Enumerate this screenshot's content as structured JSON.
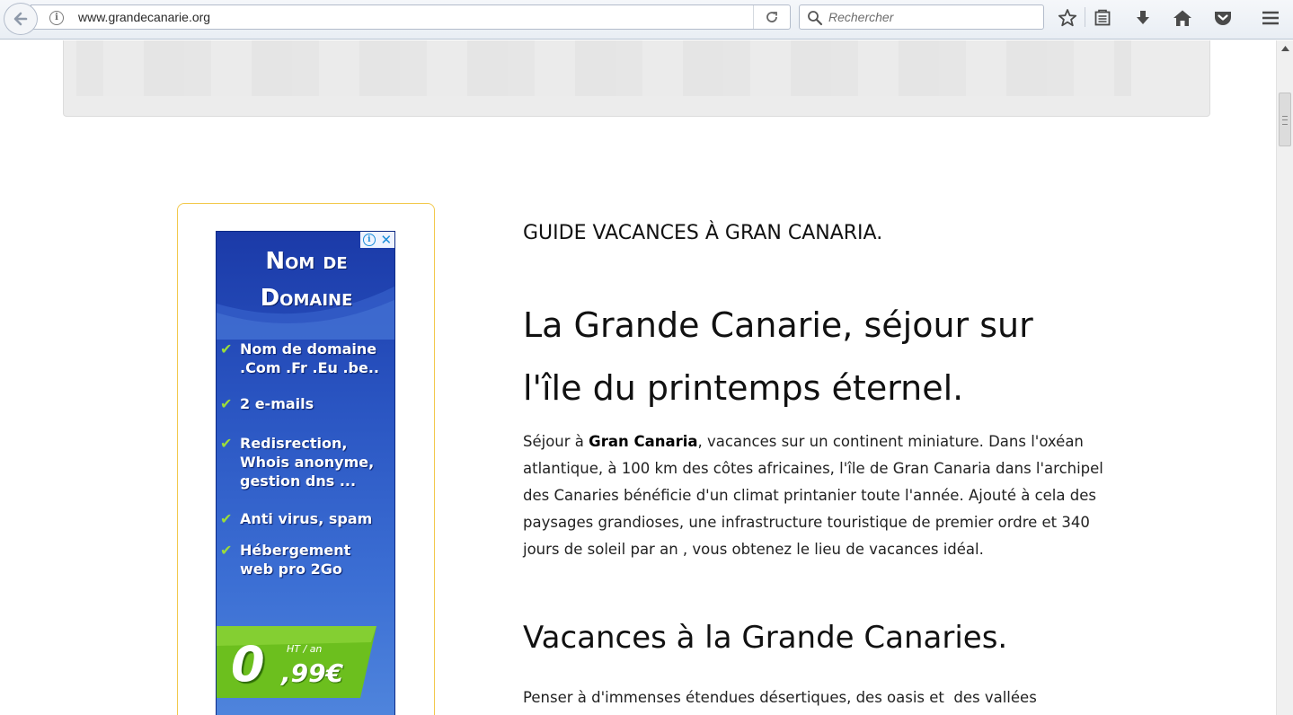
{
  "browser": {
    "url": "www.grandecanarie.org",
    "search_placeholder": "Rechercher",
    "icons": [
      "back-arrow-icon",
      "info-icon",
      "reload-icon",
      "search-icon",
      "bookmark-star-icon",
      "reading-list-icon",
      "download-icon",
      "home-icon",
      "pocket-icon",
      "menu-icon"
    ]
  },
  "ad": {
    "title_line1": "Nom de",
    "title_line2": "Domaine",
    "items": [
      "Nom de domaine\n.Com .Fr .Eu .be..",
      "2 e-mails",
      "Redisrection,\nWhois anonyme,\ngestion dns ...",
      "Anti virus, spam",
      "Hébergement\nweb pro 2Go"
    ],
    "price_main": "0",
    "price_decimal": ",99€",
    "price_unit": "HT / an",
    "colors": {
      "background": "#2a55c2",
      "check": "#9bdc3a",
      "price_band": "#6cbf1e"
    }
  },
  "article": {
    "kicker": "GUIDE VACANCES À GRAN CANARIA.",
    "title": "La Grande Canarie, séjour sur l'île du printemps éternel.",
    "para1_prefix": "Séjour à ",
    "para1_bold": "Gran Canaria",
    "para1_rest": ", vacances sur un continent miniature. Dans l'oxéan atlantique, à 100 km des côtes africaines, l'île de Gran Canaria dans l'archipel des Canaries bénéficie d'un climat printanier toute l'année. Ajouté à cela des paysages grandioses, une infrastructure touristique de premier ordre et 340 jours de soleil par an , vous obtenez le lieu de vacances idéal.",
    "subtitle": "Vacances à la Grande Canaries.",
    "para2": "Penser à d'immenses étendues désertiques, des oasis et  des vallées"
  },
  "colors": {
    "ad_frame_border": "#f2c94c",
    "header_box": "#ececec"
  }
}
